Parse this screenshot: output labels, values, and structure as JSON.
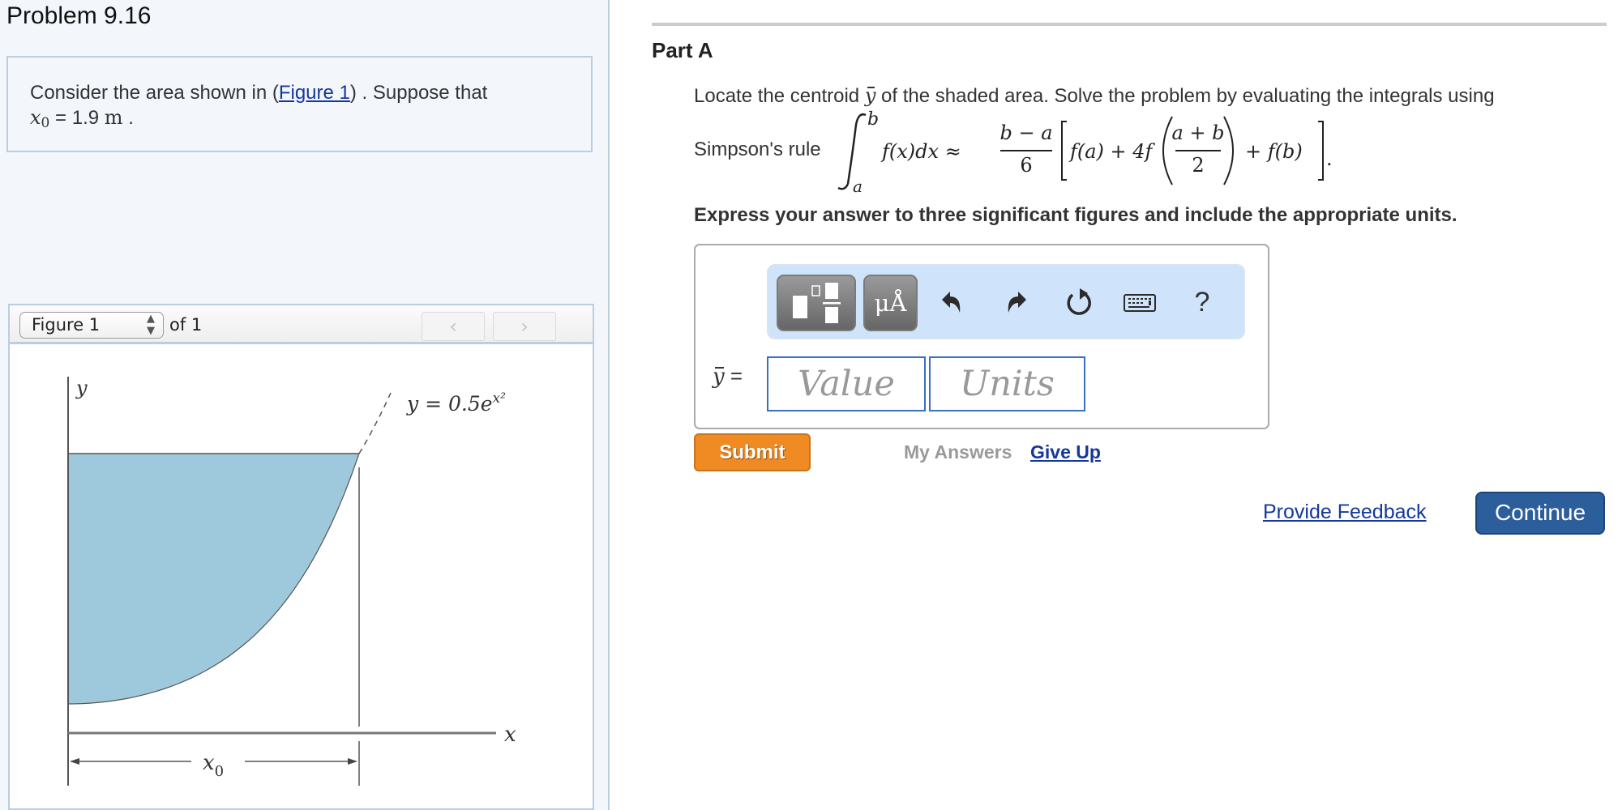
{
  "problem": {
    "title": "Problem 9.16",
    "text_before_link": "Consider the area shown in (",
    "link_text": "Figure 1",
    "text_after_link": ") . Suppose that",
    "var_symbol": "x",
    "var_subscript": "0",
    "equals_value": " = 1.9 ",
    "unit": "m",
    "end_period": " ."
  },
  "figure": {
    "select_value": "Figure 1",
    "of_label": "of 1",
    "prev_label": "‹",
    "next_label": "›",
    "y_axis_label": "y",
    "x_axis_label": "x",
    "curve_label_lhs": "y = 0.5e",
    "curve_label_sup": "x²",
    "dimension_label": "x",
    "dimension_sub": "0",
    "fill_color": "#9ec9dd"
  },
  "part": {
    "title": "Part A",
    "question_before": "Locate the centroid ",
    "question_symbol": "y",
    "question_after": " of the shaded area. Solve the problem by evaluating the integrals using",
    "simpson_label": "Simpson's rule",
    "formula": {
      "upper": "b",
      "lower": "a",
      "integrand": "f(x)dx ≈",
      "frac_num": "b − a",
      "frac_den": "6",
      "bracket_left": "f(a) + 4f",
      "inner_num": "a + b",
      "inner_den": "2",
      "bracket_right": "+ f(b)",
      "end": "."
    },
    "instruction": "Express your answer to three significant figures and include the appropriate units."
  },
  "answer": {
    "toolbar": {
      "templates_icon": "templates-icon",
      "units_label": "μÅ",
      "undo_icon": "undo-icon",
      "redo_icon": "redo-icon",
      "reset_icon": "reset-icon",
      "keyboard_icon": "keyboard-icon",
      "help_label": "?"
    },
    "variable_symbol": "y",
    "equals": " =",
    "value_placeholder": "Value",
    "units_placeholder": "Units"
  },
  "actions": {
    "submit_label": "Submit",
    "my_answers_label": "My Answers",
    "give_up_label": "Give Up",
    "provide_feedback_label": "Provide Feedback",
    "continue_label": "Continue"
  },
  "colors": {
    "submit": "#ef8b22",
    "continue": "#2d5e9c",
    "link": "#14389c",
    "panel_bg": "#f3f7fc",
    "toolbar_bg": "#cfe4fb"
  }
}
